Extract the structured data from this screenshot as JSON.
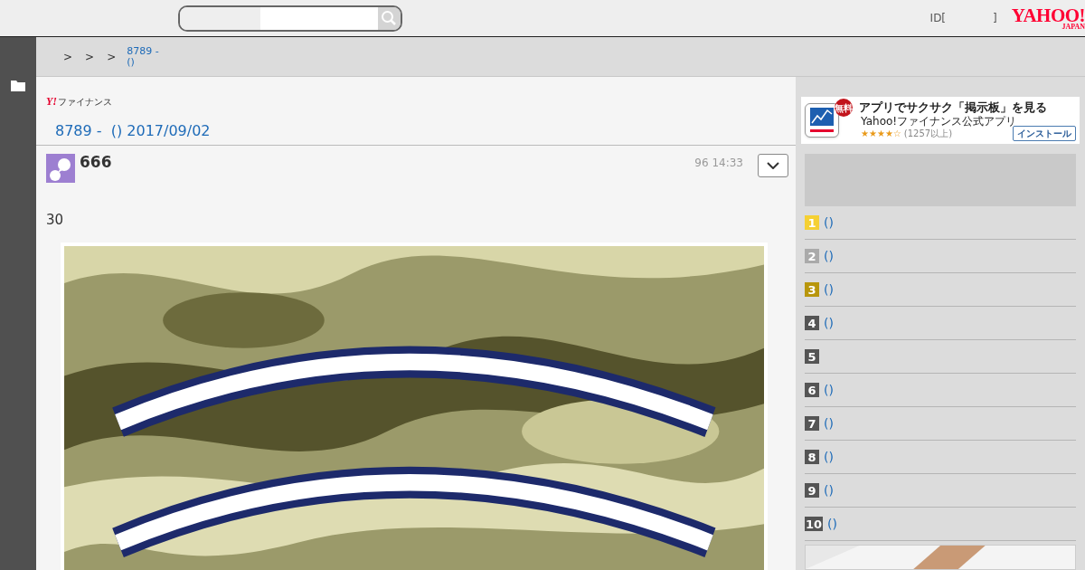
{
  "header": {
    "user_label": "ID[",
    "user_close": "]",
    "logo": {
      "main": "YAHOO!",
      "sub": "JAPAN"
    }
  },
  "breadcrumb": {
    "separators": [
      ">",
      ">",
      ">"
    ],
    "current": [
      "8789 -",
      "()"
    ]
  },
  "board": {
    "brand": {
      "mark": "Y!",
      "name": "ファイナンス"
    },
    "title": "8789 -  () 2017/09/02"
  },
  "post": {
    "author": "666",
    "time": "96 14:33",
    "body": "30"
  },
  "app_banner": {
    "badge": "無料",
    "title": "アプリでサクサク「掲示板」を見る",
    "subtitle": "Yahoo!ファイナンス公式アプリ",
    "stars": 4,
    "reviews": "(1257以上)",
    "install": "インストール"
  },
  "ranking": [
    {
      "rank": "1",
      "color": "#f5d033",
      "label": "()"
    },
    {
      "rank": "2",
      "color": "#aaaaaa",
      "label": "()"
    },
    {
      "rank": "3",
      "color": "#b8960c",
      "label": "()"
    },
    {
      "rank": "4",
      "color": "#555555",
      "label": "()"
    },
    {
      "rank": "5",
      "color": "#555555"
    },
    {
      "rank": "6",
      "color": "#555555",
      "label": "()"
    },
    {
      "rank": "7",
      "color": "#555555",
      "label": "()"
    },
    {
      "rank": "8",
      "color": "#555555",
      "label": "()"
    },
    {
      "rank": "9",
      "color": "#555555",
      "label": "()"
    },
    {
      "rank": "10",
      "color": "#555555",
      "label": "()"
    }
  ]
}
